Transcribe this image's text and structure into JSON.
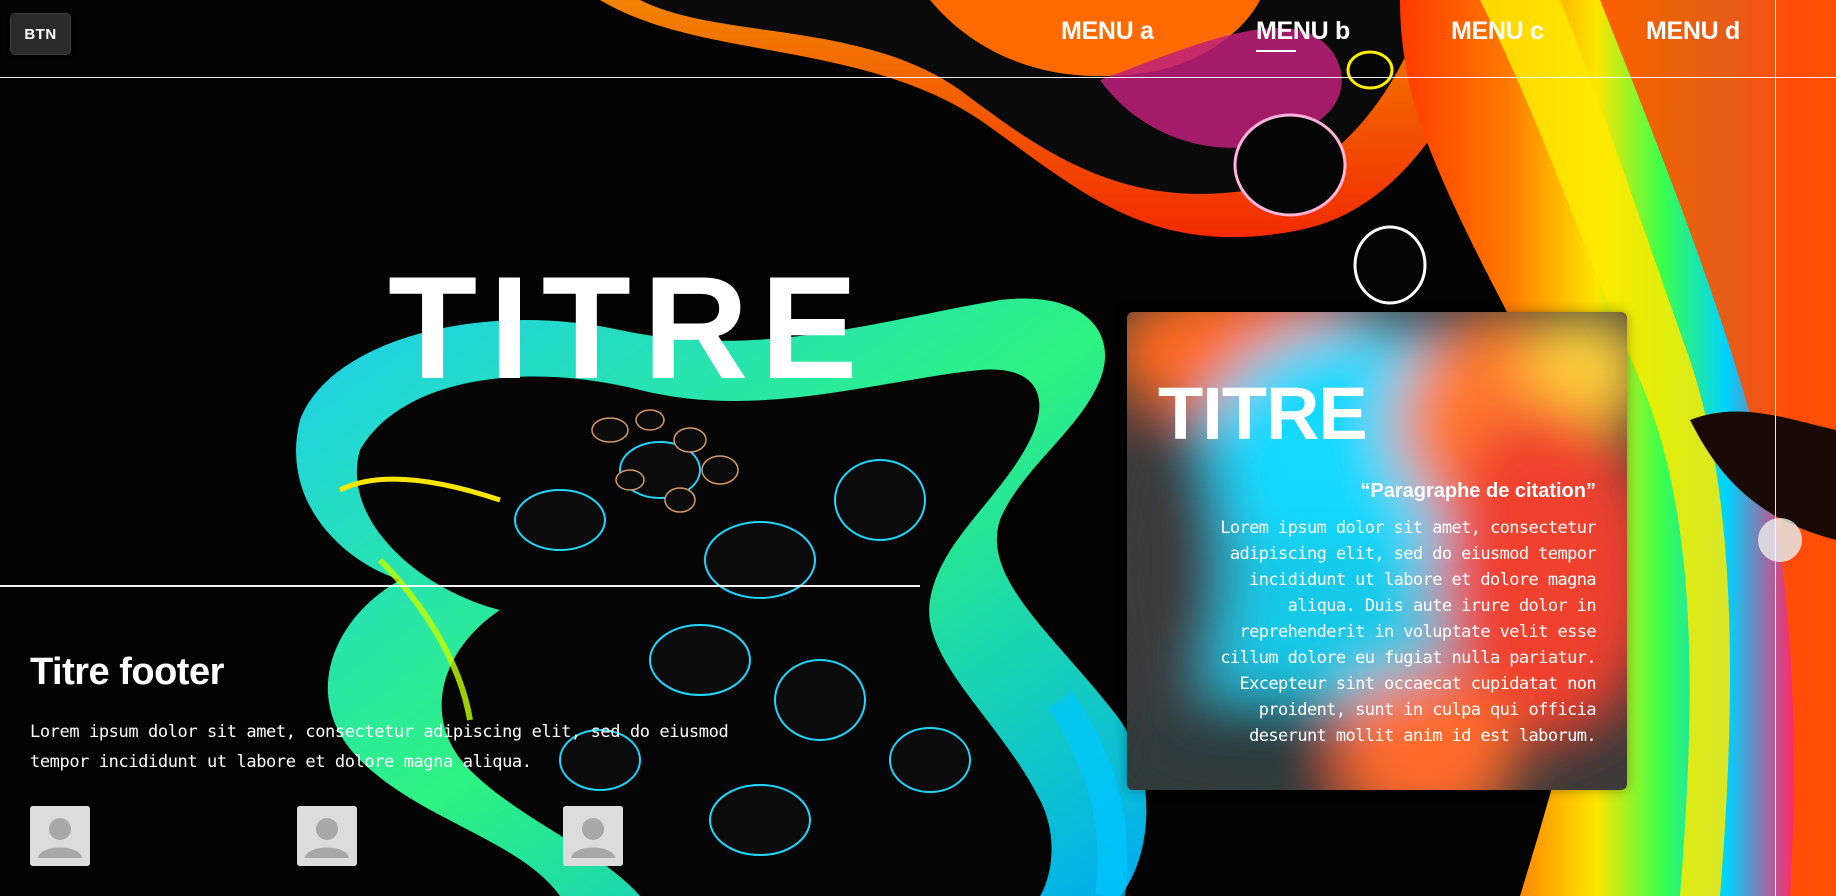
{
  "header": {
    "button_label": "BTN",
    "menu": [
      {
        "label": "MENU a",
        "active": false
      },
      {
        "label": "MENU b",
        "active": true
      },
      {
        "label": "MENU c",
        "active": false
      },
      {
        "label": "MENU d",
        "active": false
      }
    ]
  },
  "hero": {
    "title": "TITRE"
  },
  "card": {
    "title": "TITRE",
    "quote": "“Paragraphe de citation”",
    "body": "Lorem ipsum dolor sit amet, consectetur adipiscing elit, sed do eiusmod tempor incididunt ut labore et dolore magna aliqua. Duis aute irure dolor in reprehenderit in voluptate velit esse cillum dolore eu fugiat nulla pariatur. Excepteur sint occaecat cupidatat non proident, sunt in culpa qui officia deserunt mollit anim id est laborum."
  },
  "footer": {
    "title": "Titre footer",
    "text": "Lorem ipsum dolor sit amet, consectetur adipiscing elit, sed do eiusmod tempor incididunt ut labore et dolore magna aliqua.",
    "avatars": [
      "user-avatar-icon",
      "user-avatar-icon",
      "user-avatar-icon"
    ]
  },
  "colors": {
    "background": "#000000",
    "text": "#ffffff",
    "button_bg": "#2a2a2a"
  }
}
